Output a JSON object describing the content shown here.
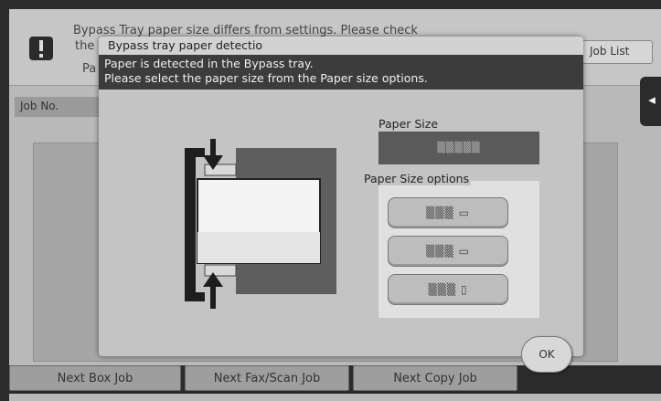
{
  "background": {
    "warning_line1": "Bypass Tray paper size differs from settings. Please check",
    "warning_line2_fragment": "the",
    "warning_line3_fragment": "Pa",
    "job_list_button": "Job List",
    "side_tab_symbol": "◂",
    "job_no_header": "Job No."
  },
  "dialog": {
    "title": "Bypass tray paper detectio",
    "message_line1": "Paper is detected in the Bypass tray.",
    "message_line2": "Please select the paper size from the Paper size options.",
    "paper_size_label": "Paper Size",
    "paper_size_value": "▒▒▒▒▒",
    "paper_size_options_label": "Paper Size options",
    "options": [
      {
        "label": "▒▒▒ ▭"
      },
      {
        "label": "▒▒▒ ▭"
      },
      {
        "label": "▒▒▒ ▯"
      }
    ],
    "ok_button": "OK"
  },
  "bottom_bar": {
    "buttons": [
      {
        "label": "Next Box Job"
      },
      {
        "label": "Next Fax/Scan Job"
      },
      {
        "label": "Next Copy Job"
      }
    ]
  },
  "colors": {
    "screen_bg": "#b9b9b9",
    "dialog_bg": "#c4c4c4",
    "message_bg": "#3c3c3c",
    "bezel": "#2b2b2b"
  }
}
